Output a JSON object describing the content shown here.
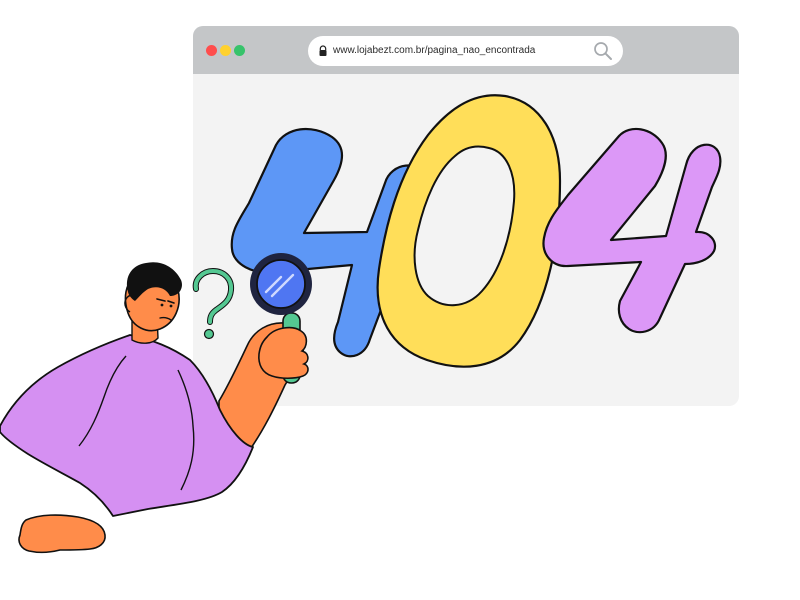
{
  "browser": {
    "address_url": "www.lojabezt.com.br/pagina_nao_encontrada",
    "window_controls": [
      "close",
      "minimize",
      "maximize"
    ],
    "icons": {
      "lock": "lock-icon",
      "search": "search-icon"
    }
  },
  "error_code": {
    "digits": [
      "4",
      "0",
      "4"
    ],
    "colors": {
      "first_four": "#5d97f6",
      "zero": "#ffde59",
      "second_four": "#dc98f7"
    }
  },
  "illustration": {
    "character": "person-with-magnifying-glass",
    "question_mark": "?",
    "colors": {
      "question_mark": "#54c892",
      "shirt": "#d590f2",
      "skin": "#ff8c4a",
      "hair": "#111111",
      "lens": "#4f76f2",
      "handle": "#54c892"
    }
  }
}
